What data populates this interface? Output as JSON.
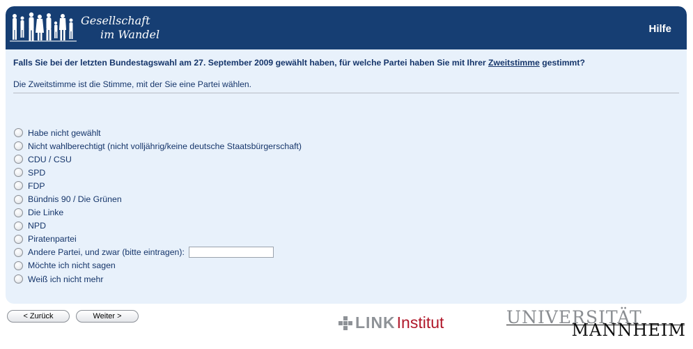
{
  "header": {
    "logo_line1": "Gesellschaft",
    "logo_line2": "im Wandel",
    "help_label": "Hilfe"
  },
  "question": {
    "text_before": "Falls Sie bei der letzten Bundestagswahl am 27. September 2009 gewählt haben, für welche Partei haben Sie mit Ihrer ",
    "underlined": "Zweitstimme",
    "text_after": " gestimmt?",
    "instruction": "Die Zweitstimme ist die Stimme, mit der Sie eine Partei wählen."
  },
  "options": [
    "Habe nicht gewählt",
    "Nicht wahlberechtigt (nicht volljährig/keine deutsche Staatsbürgerschaft)",
    "CDU / CSU",
    "SPD",
    "FDP",
    "Bündnis 90 / Die Grünen",
    "Die Linke",
    "NPD",
    "Piratenpartei",
    "Andere Partei, und zwar (bitte eintragen):",
    "Möchte ich nicht sagen",
    "Weiß ich nicht mehr"
  ],
  "other_input_value": "",
  "nav": {
    "back_label": "< Zurück",
    "next_label": "Weiter >"
  },
  "footer": {
    "link_word": "LINK",
    "link_institut": "Institut",
    "uni_top": "UNIVERSITÄT",
    "uni_bottom": "MANNHEIM"
  },
  "colors": {
    "header_bg": "#163e73",
    "panel_bg": "#e8f1fb",
    "text": "#15356a",
    "link_red": "#b0182a"
  }
}
